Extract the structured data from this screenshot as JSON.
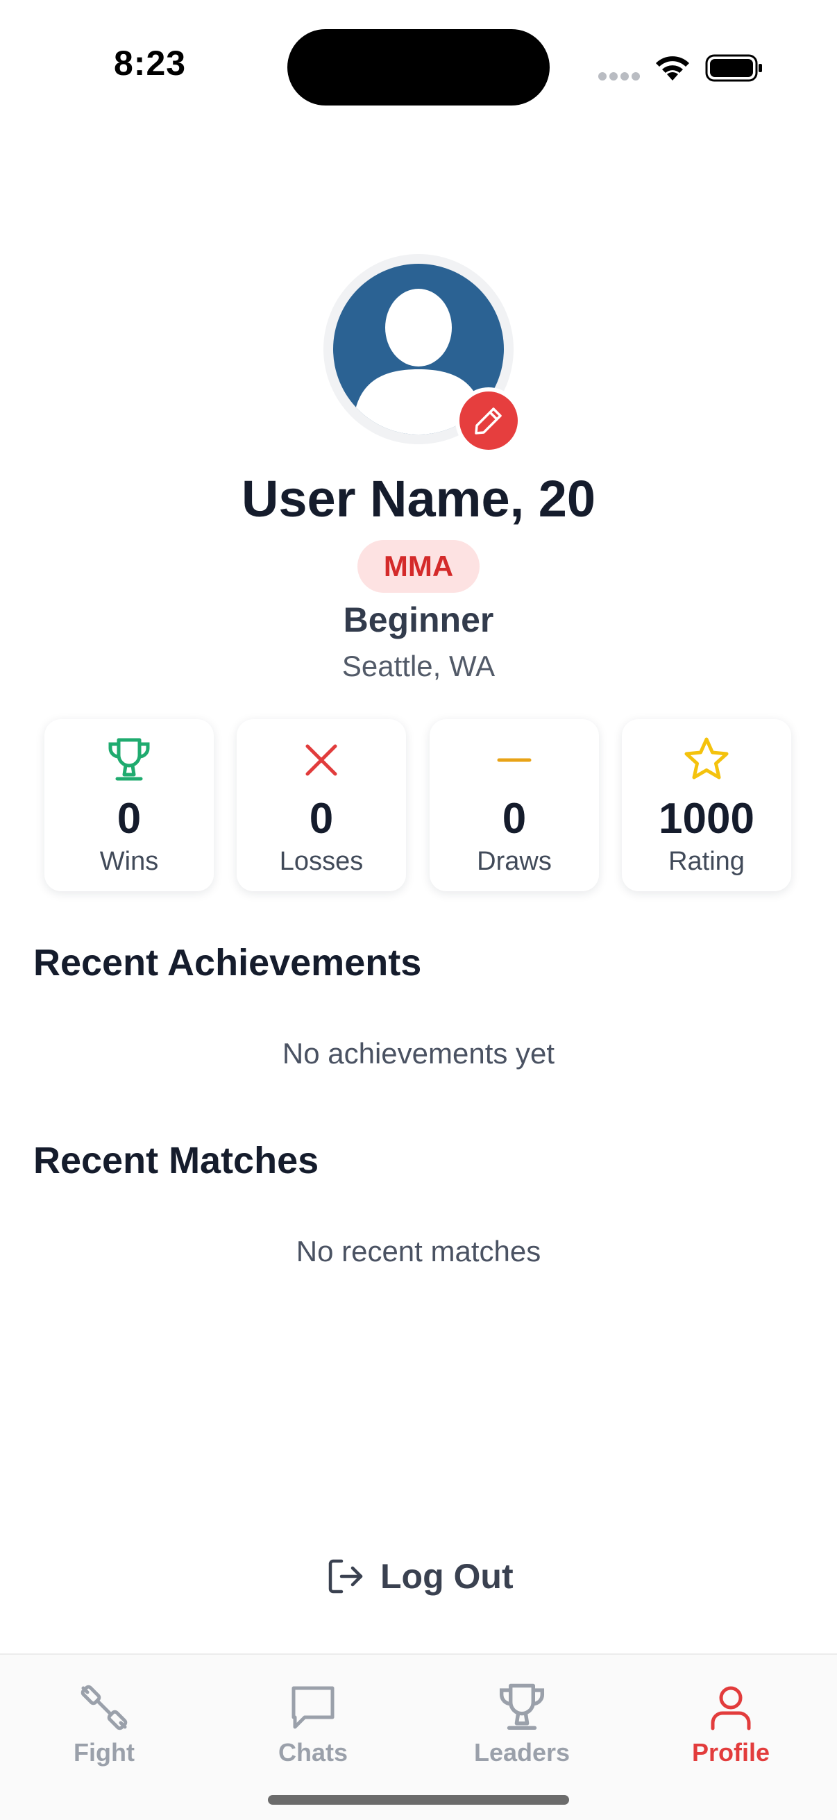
{
  "status_bar": {
    "time": "8:23"
  },
  "profile": {
    "name_age": "User Name, 20",
    "discipline": "MMA",
    "level": "Beginner",
    "location": "Seattle, WA"
  },
  "stats": [
    {
      "icon": "trophy-icon",
      "value": "0",
      "label": "Wins",
      "color": "#1fab6f"
    },
    {
      "icon": "x-icon",
      "value": "0",
      "label": "Losses",
      "color": "#e13c3c"
    },
    {
      "icon": "minus-icon",
      "value": "0",
      "label": "Draws",
      "color": "#e8a317"
    },
    {
      "icon": "star-icon",
      "value": "1000",
      "label": "Rating",
      "color": "#f4c20d"
    }
  ],
  "achievements": {
    "title": "Recent Achievements",
    "empty_text": "No achievements yet"
  },
  "matches": {
    "title": "Recent Matches",
    "empty_text": "No recent matches"
  },
  "logout_label": "Log Out",
  "tabs": [
    {
      "label": "Fight",
      "icon": "dumbbell-icon",
      "active": false
    },
    {
      "label": "Chats",
      "icon": "chat-bubble-icon",
      "active": false
    },
    {
      "label": "Leaders",
      "icon": "trophy-icon",
      "active": false
    },
    {
      "label": "Profile",
      "icon": "user-icon",
      "active": true
    }
  ],
  "colors": {
    "accent": "#e23c3c",
    "avatar_bg": "#2b6293",
    "inactive_tab": "#9aa0aa"
  }
}
